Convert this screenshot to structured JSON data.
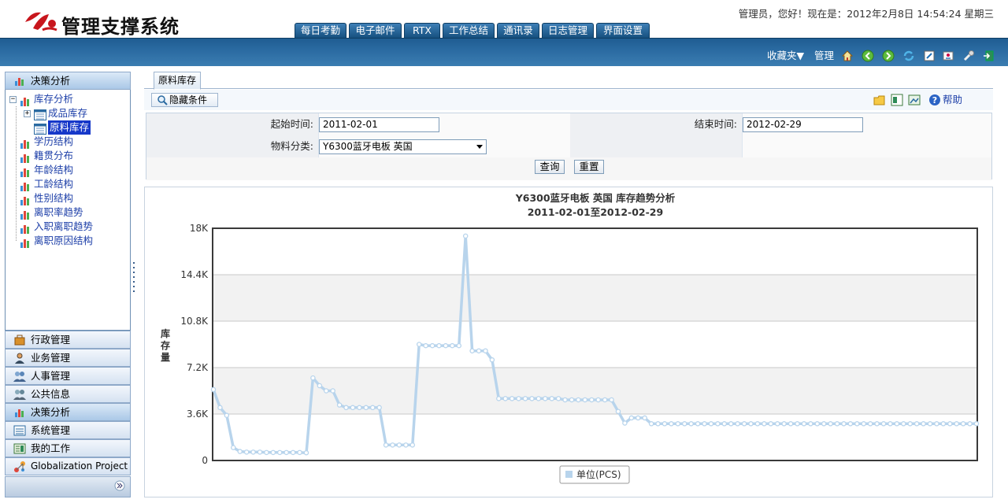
{
  "app": {
    "title": "管理支撑系统",
    "welcome": "管理员，您好！现在是：2012年2月8日  14:54:24 星期三"
  },
  "top_tabs": [
    "每日考勤",
    "电子邮件",
    "RTX",
    "工作总结",
    "通讯录",
    "日志管理",
    "界面设置"
  ],
  "nav_tools": {
    "favorites": "收藏夹▼",
    "manage": "管理",
    "icons": [
      "home-icon",
      "back-icon",
      "forward-icon",
      "refresh-icon",
      "edit-icon",
      "user-icon",
      "tools-icon",
      "exit-icon"
    ]
  },
  "sidebar": {
    "header": "决策分析",
    "tree": [
      {
        "label": "库存分析",
        "level": 0,
        "expanded": true
      },
      {
        "label": "成品库存",
        "level": 1,
        "expanded": false
      },
      {
        "label": "原料库存",
        "level": 1,
        "selected": true
      },
      {
        "label": "学历结构",
        "level": 0
      },
      {
        "label": "籍贯分布",
        "level": 0
      },
      {
        "label": "年龄结构",
        "level": 0
      },
      {
        "label": "工龄结构",
        "level": 0
      },
      {
        "label": "性别结构",
        "level": 0
      },
      {
        "label": "离职率趋势",
        "level": 0
      },
      {
        "label": "入职离职趋势",
        "level": 0
      },
      {
        "label": "离职原因结构",
        "level": 0
      }
    ],
    "sections": [
      "行政管理",
      "业务管理",
      "人事管理",
      "公共信息",
      "决策分析",
      "系统管理",
      "我的工作",
      "Globalization Project"
    ],
    "active_section": "决策分析"
  },
  "main": {
    "tab": "原料库存",
    "hide_button": "隐藏条件",
    "help": "帮助",
    "form": {
      "start_label": "起始时间:",
      "start_value": "2011-02-01",
      "end_label": "结束时间:",
      "end_value": "2012-02-29",
      "category_label": "物料分类:",
      "category_value": "Y6300蓝牙电板 英国",
      "query": "查询",
      "reset": "重置"
    }
  },
  "chart_data": {
    "type": "line",
    "title": "Y6300蓝牙电板 英国 库存趋势分析",
    "subtitle": "2011-02-01至2012-02-29",
    "ylabel": "库存量",
    "ylim": [
      0,
      18000
    ],
    "yticks": [
      "0",
      "3.6K",
      "7.2K",
      "10.8K",
      "14.4K",
      "18K"
    ],
    "ytick_values": [
      0,
      3600,
      7200,
      10800,
      14400,
      18000
    ],
    "grid": true,
    "legend_position": "bottom-center",
    "series_color": "#b8d4ec",
    "series": [
      {
        "name": "单位(PCS)",
        "values": [
          5500,
          4100,
          3500,
          1000,
          700,
          650,
          650,
          650,
          620,
          620,
          620,
          620,
          620,
          620,
          600,
          6400,
          5800,
          5400,
          5400,
          4300,
          4100,
          4100,
          4100,
          4100,
          4100,
          4100,
          1200,
          1200,
          1200,
          1200,
          1200,
          9000,
          8900,
          8900,
          8900,
          8900,
          8900,
          8900,
          17400,
          8500,
          8500,
          8500,
          7800,
          4800,
          4800,
          4800,
          4800,
          4800,
          4800,
          4800,
          4800,
          4800,
          4800,
          4700,
          4700,
          4700,
          4700,
          4700,
          4700,
          4700,
          4700,
          3800,
          2900,
          3300,
          3300,
          3300,
          2850,
          2850,
          2850,
          2850,
          2850,
          2850,
          2850,
          2850,
          2850,
          2850,
          2850,
          2850,
          2850,
          2850,
          2850,
          2850,
          2850,
          2850,
          2850,
          2850,
          2850,
          2850,
          2850,
          2850,
          2850,
          2850,
          2850,
          2850,
          2850,
          2850,
          2850,
          2850,
          2850,
          2850,
          2850,
          2850,
          2850,
          2850,
          2850,
          2850,
          2850,
          2850,
          2850,
          2850,
          2850,
          2850,
          2850,
          2850,
          2850,
          2850
        ]
      }
    ]
  }
}
